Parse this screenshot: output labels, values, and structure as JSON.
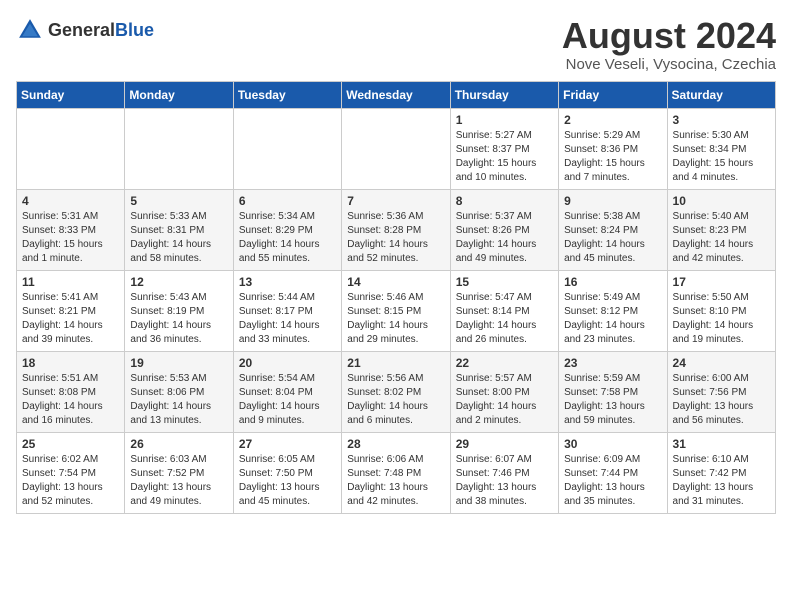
{
  "header": {
    "logo_general": "General",
    "logo_blue": "Blue",
    "month_year": "August 2024",
    "location": "Nove Veseli, Vysocina, Czechia"
  },
  "weekdays": [
    "Sunday",
    "Monday",
    "Tuesday",
    "Wednesday",
    "Thursday",
    "Friday",
    "Saturday"
  ],
  "weeks": [
    [
      {
        "day": "",
        "info": ""
      },
      {
        "day": "",
        "info": ""
      },
      {
        "day": "",
        "info": ""
      },
      {
        "day": "",
        "info": ""
      },
      {
        "day": "1",
        "info": "Sunrise: 5:27 AM\nSunset: 8:37 PM\nDaylight: 15 hours\nand 10 minutes."
      },
      {
        "day": "2",
        "info": "Sunrise: 5:29 AM\nSunset: 8:36 PM\nDaylight: 15 hours\nand 7 minutes."
      },
      {
        "day": "3",
        "info": "Sunrise: 5:30 AM\nSunset: 8:34 PM\nDaylight: 15 hours\nand 4 minutes."
      }
    ],
    [
      {
        "day": "4",
        "info": "Sunrise: 5:31 AM\nSunset: 8:33 PM\nDaylight: 15 hours\nand 1 minute."
      },
      {
        "day": "5",
        "info": "Sunrise: 5:33 AM\nSunset: 8:31 PM\nDaylight: 14 hours\nand 58 minutes."
      },
      {
        "day": "6",
        "info": "Sunrise: 5:34 AM\nSunset: 8:29 PM\nDaylight: 14 hours\nand 55 minutes."
      },
      {
        "day": "7",
        "info": "Sunrise: 5:36 AM\nSunset: 8:28 PM\nDaylight: 14 hours\nand 52 minutes."
      },
      {
        "day": "8",
        "info": "Sunrise: 5:37 AM\nSunset: 8:26 PM\nDaylight: 14 hours\nand 49 minutes."
      },
      {
        "day": "9",
        "info": "Sunrise: 5:38 AM\nSunset: 8:24 PM\nDaylight: 14 hours\nand 45 minutes."
      },
      {
        "day": "10",
        "info": "Sunrise: 5:40 AM\nSunset: 8:23 PM\nDaylight: 14 hours\nand 42 minutes."
      }
    ],
    [
      {
        "day": "11",
        "info": "Sunrise: 5:41 AM\nSunset: 8:21 PM\nDaylight: 14 hours\nand 39 minutes."
      },
      {
        "day": "12",
        "info": "Sunrise: 5:43 AM\nSunset: 8:19 PM\nDaylight: 14 hours\nand 36 minutes."
      },
      {
        "day": "13",
        "info": "Sunrise: 5:44 AM\nSunset: 8:17 PM\nDaylight: 14 hours\nand 33 minutes."
      },
      {
        "day": "14",
        "info": "Sunrise: 5:46 AM\nSunset: 8:15 PM\nDaylight: 14 hours\nand 29 minutes."
      },
      {
        "day": "15",
        "info": "Sunrise: 5:47 AM\nSunset: 8:14 PM\nDaylight: 14 hours\nand 26 minutes."
      },
      {
        "day": "16",
        "info": "Sunrise: 5:49 AM\nSunset: 8:12 PM\nDaylight: 14 hours\nand 23 minutes."
      },
      {
        "day": "17",
        "info": "Sunrise: 5:50 AM\nSunset: 8:10 PM\nDaylight: 14 hours\nand 19 minutes."
      }
    ],
    [
      {
        "day": "18",
        "info": "Sunrise: 5:51 AM\nSunset: 8:08 PM\nDaylight: 14 hours\nand 16 minutes."
      },
      {
        "day": "19",
        "info": "Sunrise: 5:53 AM\nSunset: 8:06 PM\nDaylight: 14 hours\nand 13 minutes."
      },
      {
        "day": "20",
        "info": "Sunrise: 5:54 AM\nSunset: 8:04 PM\nDaylight: 14 hours\nand 9 minutes."
      },
      {
        "day": "21",
        "info": "Sunrise: 5:56 AM\nSunset: 8:02 PM\nDaylight: 14 hours\nand 6 minutes."
      },
      {
        "day": "22",
        "info": "Sunrise: 5:57 AM\nSunset: 8:00 PM\nDaylight: 14 hours\nand 2 minutes."
      },
      {
        "day": "23",
        "info": "Sunrise: 5:59 AM\nSunset: 7:58 PM\nDaylight: 13 hours\nand 59 minutes."
      },
      {
        "day": "24",
        "info": "Sunrise: 6:00 AM\nSunset: 7:56 PM\nDaylight: 13 hours\nand 56 minutes."
      }
    ],
    [
      {
        "day": "25",
        "info": "Sunrise: 6:02 AM\nSunset: 7:54 PM\nDaylight: 13 hours\nand 52 minutes."
      },
      {
        "day": "26",
        "info": "Sunrise: 6:03 AM\nSunset: 7:52 PM\nDaylight: 13 hours\nand 49 minutes."
      },
      {
        "day": "27",
        "info": "Sunrise: 6:05 AM\nSunset: 7:50 PM\nDaylight: 13 hours\nand 45 minutes."
      },
      {
        "day": "28",
        "info": "Sunrise: 6:06 AM\nSunset: 7:48 PM\nDaylight: 13 hours\nand 42 minutes."
      },
      {
        "day": "29",
        "info": "Sunrise: 6:07 AM\nSunset: 7:46 PM\nDaylight: 13 hours\nand 38 minutes."
      },
      {
        "day": "30",
        "info": "Sunrise: 6:09 AM\nSunset: 7:44 PM\nDaylight: 13 hours\nand 35 minutes."
      },
      {
        "day": "31",
        "info": "Sunrise: 6:10 AM\nSunset: 7:42 PM\nDaylight: 13 hours\nand 31 minutes."
      }
    ]
  ]
}
